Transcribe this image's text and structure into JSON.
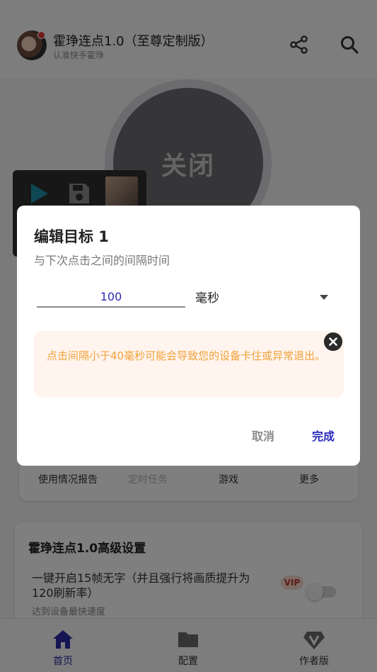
{
  "app": {
    "title": "霍琤连点1.0（至尊定制版）",
    "subtitle": "认准快手霍琤",
    "header_icons": [
      "share-icon",
      "search-icon"
    ]
  },
  "power": {
    "label": "关闭"
  },
  "floating_panel": {
    "icons": [
      "play-icon",
      "save-icon",
      "avatar-thumbnail"
    ]
  },
  "functions": {
    "items": [
      {
        "label": "使用情况报告",
        "enabled": true
      },
      {
        "label": "定时任务",
        "enabled": false
      },
      {
        "label": "游戏",
        "enabled": true
      },
      {
        "label": "更多",
        "enabled": true
      }
    ]
  },
  "advanced": {
    "title": "霍琤连点1.0高级设置",
    "option_line1": "一键开启15帧无字（并且强行将画质提升为",
    "option_line2": "120刷新率）",
    "option_badge": "VIP",
    "option_desc": "达到设备最快速度",
    "option_enabled": false
  },
  "bottom_nav": {
    "items": [
      {
        "label": "首页",
        "icon": "home-icon",
        "active": true
      },
      {
        "label": "配置",
        "icon": "folder-icon",
        "active": false
      },
      {
        "label": "作者版",
        "icon": "vip-diamond-icon",
        "active": false
      }
    ]
  },
  "dialog": {
    "title": "编辑目标 1",
    "subtitle": "与下次点击之间的间隔时间",
    "interval_value": "100",
    "unit": "毫秒",
    "warning": "点击间隔小于40毫秒可能会导致您的设备卡住或异常退出。",
    "cancel_label": "取消",
    "done_label": "完成"
  },
  "colors": {
    "accent": "#2a2ac0",
    "warning_text": "#f0a23a",
    "warning_bg": "#fff4ee"
  }
}
